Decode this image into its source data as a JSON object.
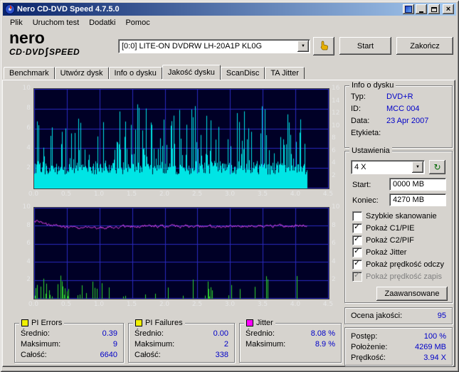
{
  "window": {
    "title": "Nero CD-DVD Speed 4.7.5.0"
  },
  "icons": {
    "dropdown": "▼",
    "close": "×",
    "check": "✓",
    "refresh": "↻"
  },
  "colors": {
    "value_blue": "#0000C8",
    "chart_bg": "#000026",
    "chart_grid": "#2A2ABE",
    "pie_cyan": "#00E5E5",
    "pif_green": "#2FD42F",
    "jitter_magenta": "#FF4CFF",
    "legend_yellow": "#F0F000"
  },
  "menu": {
    "items": [
      "Plik",
      "Uruchom test",
      "Dodatki",
      "Pomoc"
    ]
  },
  "header": {
    "logo_line1": "nero",
    "logo_line2a": "CD·DVD",
    "logo_swoosh": "∫",
    "logo_line2b": "SPEED",
    "drive": "[0:0]  LITE-ON DVDRW LH-20A1P KL0G",
    "start_label": "Start",
    "quit_label": "Zakończ"
  },
  "tabs": {
    "items": [
      "Benchmark",
      "Utwórz dysk",
      "Info o dysku",
      "Jakość dysku",
      "ScanDisc",
      "TA Jitter"
    ],
    "active": "Jakość dysku"
  },
  "disc_info": {
    "title": "Info o dysku",
    "rows": [
      {
        "label": "Typ:",
        "value": "DVD+R"
      },
      {
        "label": "ID:",
        "value": "MCC 004"
      },
      {
        "label": "Data:",
        "value": "23 Apr 2007"
      },
      {
        "label": "Etykieta:",
        "value": ""
      }
    ]
  },
  "settings": {
    "title": "Ustawienia",
    "speed": "4 X",
    "start_label": "Start:",
    "start_value": "0000 MB",
    "end_label": "Koniec:",
    "end_value": "4270 MB",
    "checkboxes": [
      {
        "label": "Szybkie skanowanie",
        "checked": false,
        "disabled": false
      },
      {
        "label": "Pokaż C1/PIE",
        "checked": true,
        "disabled": false
      },
      {
        "label": "Pokaż C2/PIF",
        "checked": true,
        "disabled": false
      },
      {
        "label": "Pokaż Jitter",
        "checked": true,
        "disabled": false
      },
      {
        "label": "Pokaż prędkość odczy",
        "checked": true,
        "disabled": false
      },
      {
        "label": "Pokaż prędkość zapis",
        "checked": true,
        "disabled": true
      }
    ],
    "advanced_label": "Zaawansowane"
  },
  "quality": {
    "label": "Ocena jakości:",
    "value": "95"
  },
  "progress": {
    "rows": [
      {
        "label": "Postęp:",
        "value": "100 %"
      },
      {
        "label": "Położenie:",
        "value": "4269 MB"
      },
      {
        "label": "Prędkość:",
        "value": "3.94 X"
      }
    ]
  },
  "legend_boxes": [
    {
      "title": "PI Errors",
      "color": "#F0F000",
      "rows": [
        {
          "label": "Średnio:",
          "value": "0.39"
        },
        {
          "label": "Maksimum:",
          "value": "9"
        },
        {
          "label": "Całość:",
          "value": "6640"
        }
      ]
    },
    {
      "title": "PI Failures",
      "color": "#F0F000",
      "rows": [
        {
          "label": "Średnio:",
          "value": "0.00"
        },
        {
          "label": "Maksimum:",
          "value": "2"
        },
        {
          "label": "Całość:",
          "value": "338"
        }
      ]
    },
    {
      "title": "Jitter",
      "color": "#FF00FF",
      "rows": [
        {
          "label": "Średnio:",
          "value": "8.08 %"
        },
        {
          "label": "Maksimum:",
          "value": "8.9 %"
        }
      ]
    }
  ],
  "chart_data": [
    {
      "type": "area",
      "title": "PI Errors",
      "x_ticks": [
        "0.0",
        "0.5",
        "1.0",
        "1.5",
        "2.0",
        "2.5",
        "3.0",
        "3.5",
        "4.0",
        "4.5"
      ],
      "y_left_ticks": [
        10,
        8,
        6,
        4,
        2
      ],
      "y_right_ticks": [
        16,
        14,
        12,
        10,
        8,
        6,
        4,
        2
      ],
      "xlim": [
        0,
        4.5
      ],
      "ylim_left": [
        0,
        10
      ],
      "ylim_right": [
        0,
        16
      ],
      "grid": true,
      "series": [
        {
          "name": "PI Errors (C1/PIE)",
          "color": "#00E5E5"
        }
      ],
      "stats": {
        "average": 0.39,
        "maximum": 9,
        "total": 6640
      },
      "render": {
        "seed": 1234,
        "data_end_x": 4.17,
        "base_mean": 2.0,
        "spike_max": 8.6
      }
    },
    {
      "type": "line+spikes",
      "title": "Jitter / PI Failures",
      "x_ticks": [
        "0.0",
        "0.5",
        "1.0",
        "1.5",
        "2.0",
        "2.5",
        "3.0",
        "3.5",
        "4.0",
        "4.5"
      ],
      "y_left_ticks": [
        10,
        8,
        6,
        4,
        2
      ],
      "y_right_ticks": [
        10,
        8,
        6,
        4,
        2
      ],
      "xlim": [
        0,
        4.5
      ],
      "ylim_left": [
        0,
        10
      ],
      "ylim_right": [
        0,
        10
      ],
      "grid": true,
      "series": [
        {
          "name": "Jitter",
          "color": "#FF4CFF",
          "mean": 8.08,
          "max": 8.9
        },
        {
          "name": "PI Failures (C2/PIF)",
          "color": "#2FD42F",
          "total": 338,
          "max": 2
        }
      ],
      "stats": {
        "jitter_avg_pct": 8.08,
        "jitter_max_pct": 8.9,
        "pif_total": 338,
        "pif_max": 2
      },
      "render": {
        "seed": 777,
        "data_end_x": 4.17,
        "jitter_mean": 8.0,
        "jitter_start": 8.6,
        "pif_max_h": 2.6
      }
    }
  ]
}
